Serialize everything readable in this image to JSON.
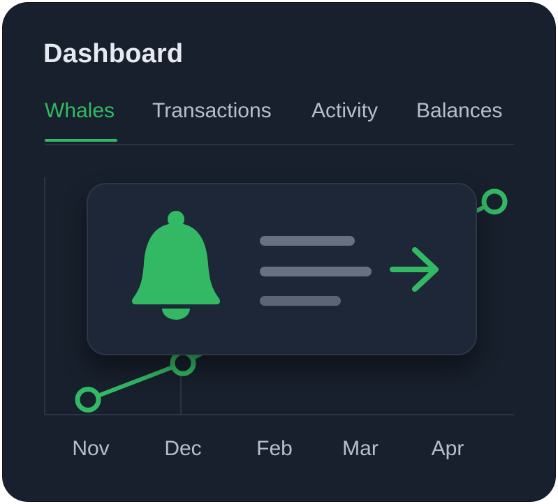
{
  "dashboard": {
    "title": "Dashboard"
  },
  "tabs": [
    {
      "label": "Whales",
      "active": true
    },
    {
      "label": "Transactions",
      "active": false
    },
    {
      "label": "Activity",
      "active": false
    },
    {
      "label": "Balances",
      "active": false
    }
  ],
  "chart_data": {
    "type": "line",
    "categories": [
      "Nov",
      "Dec",
      "Feb",
      "Mar",
      "Apr"
    ],
    "grid": false,
    "series": [
      {
        "color": "#33b964",
        "values": [
          0.06,
          0.22,
          null,
          null,
          0.93
        ]
      }
    ]
  },
  "notification": {
    "icon": "bell-icon",
    "action_icon": "arrow-right-icon",
    "accent": "#33b964"
  },
  "colors": {
    "background": "#18202d",
    "accent": "#33b964",
    "text": "#b6c0cc",
    "title": "#e6eaf0"
  }
}
